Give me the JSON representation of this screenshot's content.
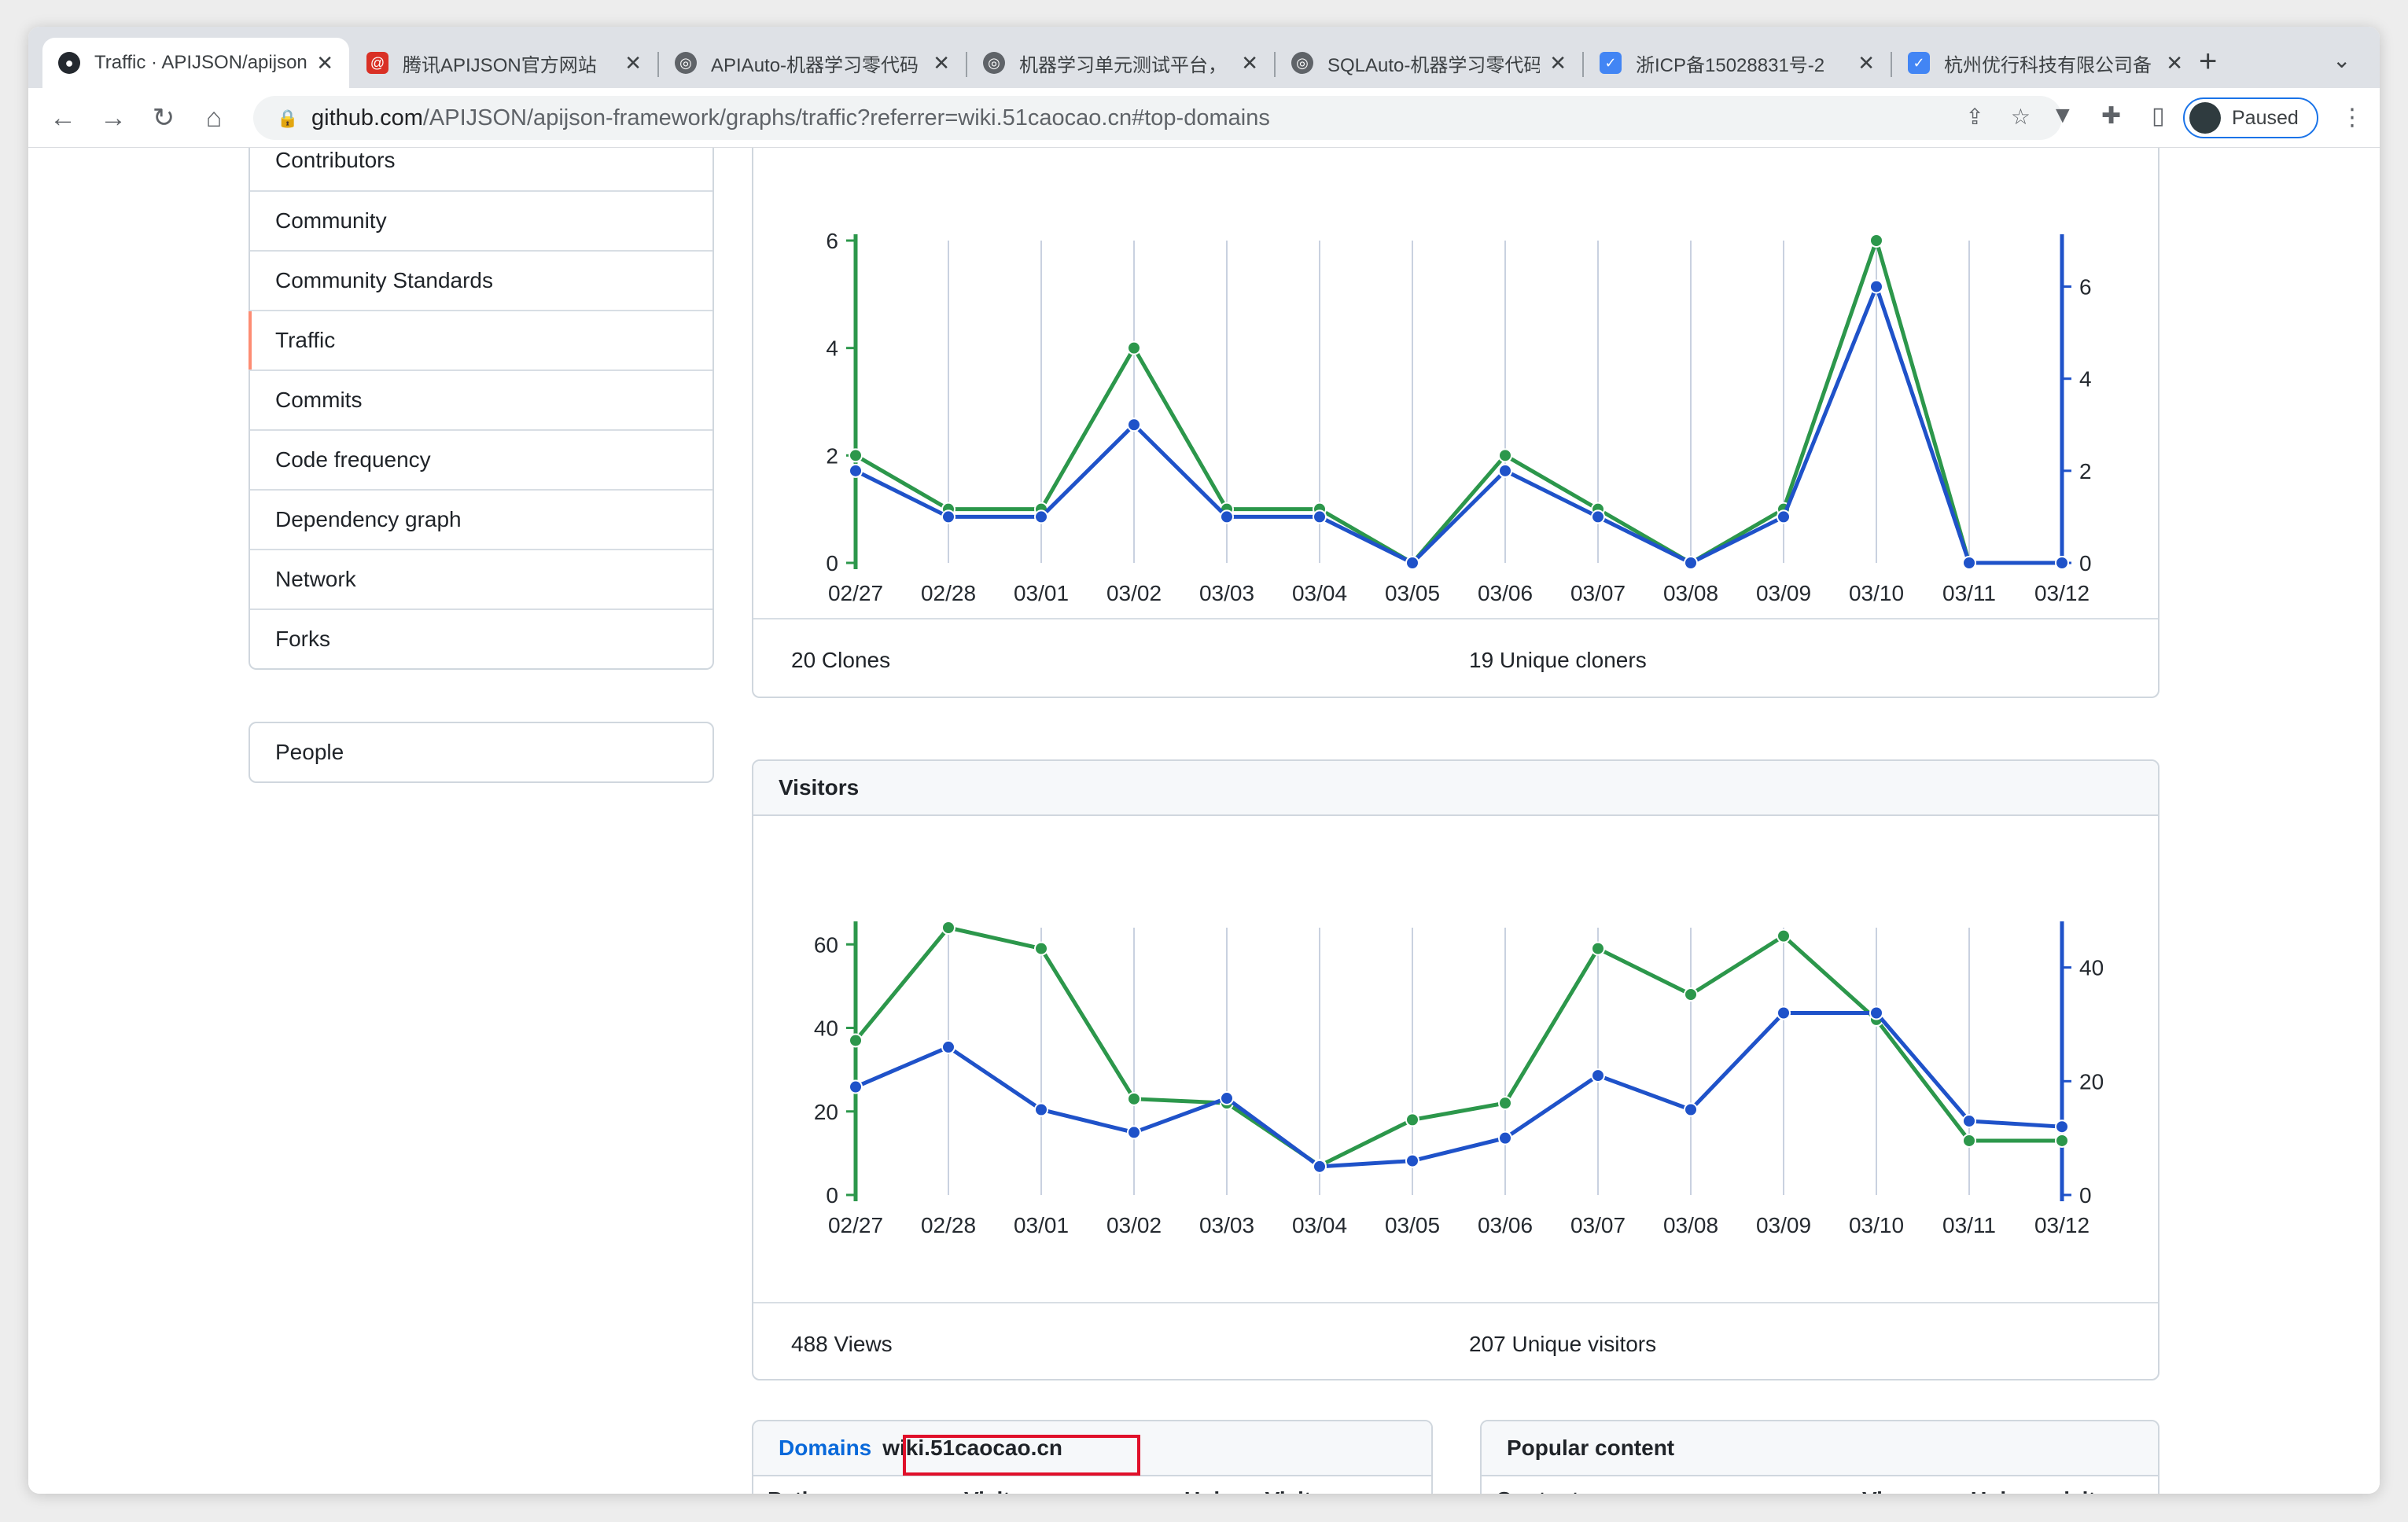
{
  "browser": {
    "tabs": [
      {
        "title": "Traffic · APIJSON/apijson",
        "favicon": "github-icon",
        "active": true
      },
      {
        "title": "腾讯APIJSON官方网站",
        "favicon": "site-icon"
      },
      {
        "title": "APIAuto-机器学习零代码",
        "favicon": "globe-icon"
      },
      {
        "title": "机器学习单元测试平台，",
        "favicon": "globe-icon"
      },
      {
        "title": "SQLAuto-机器学习零代码",
        "favicon": "globe-icon"
      },
      {
        "title": "浙ICP备15028831号-2",
        "favicon": "shield-icon"
      },
      {
        "title": "杭州优行科技有限公司备",
        "favicon": "shield-icon"
      }
    ],
    "url_host": "github.com",
    "url_rest": "/APIJSON/apijson-framework/graphs/traffic?referrer=wiki.51caocao.cn#top-domains",
    "profile_label": "Paused"
  },
  "sidebar": {
    "items": [
      {
        "label": "Contributors"
      },
      {
        "label": "Community"
      },
      {
        "label": "Community Standards"
      },
      {
        "label": "Traffic",
        "active": true
      },
      {
        "label": "Commits"
      },
      {
        "label": "Code frequency"
      },
      {
        "label": "Dependency graph"
      },
      {
        "label": "Network"
      },
      {
        "label": "Forks"
      }
    ],
    "people_label": "People"
  },
  "clones": {
    "total_label": "20 Clones",
    "unique_label": "19 Unique cloners"
  },
  "visitors": {
    "title": "Visitors",
    "total_label": "488 Views",
    "unique_label": "207 Unique visitors"
  },
  "domains": {
    "tab_label": "Domains",
    "value": "wiki.51caocao.cn",
    "columns": [
      "Path",
      "Visits",
      "Unique Visits"
    ]
  },
  "popular": {
    "title": "Popular content",
    "columns": [
      "Content",
      "Views",
      "Unique visitors"
    ]
  },
  "colors": {
    "green": "#2c974b",
    "blue": "#1f52c9",
    "accent": "#0969da"
  },
  "chart_data": [
    {
      "type": "line",
      "categories": [
        "02/27",
        "02/28",
        "03/01",
        "03/02",
        "03/03",
        "03/04",
        "03/05",
        "03/06",
        "03/07",
        "03/08",
        "03/09",
        "03/10",
        "03/11",
        "03/12"
      ],
      "series": [
        {
          "values": [
            2,
            1,
            1,
            4,
            1,
            1,
            0,
            2,
            1,
            0,
            1,
            6,
            0,
            0
          ],
          "axis": "left",
          "color": "#2c974b"
        },
        {
          "values": [
            2,
            1,
            1,
            3,
            1,
            1,
            0,
            2,
            1,
            0,
            1,
            6,
            0,
            0
          ],
          "axis": "right",
          "color": "#1f52c9"
        }
      ],
      "left_ticks": [
        "0",
        "2",
        "4",
        "6"
      ],
      "left_ylim": [
        0,
        6
      ],
      "right_ticks": [
        "0",
        "2",
        "4",
        "6"
      ],
      "right_ylim": [
        0,
        7
      ]
    },
    {
      "type": "line",
      "categories": [
        "02/27",
        "02/28",
        "03/01",
        "03/02",
        "03/03",
        "03/04",
        "03/05",
        "03/06",
        "03/07",
        "03/08",
        "03/09",
        "03/10",
        "03/11",
        "03/12"
      ],
      "series": [
        {
          "values": [
            37,
            64,
            59,
            23,
            22,
            7,
            18,
            22,
            59,
            48,
            62,
            42,
            13,
            13
          ],
          "axis": "left",
          "color": "#2c974b"
        },
        {
          "values": [
            19,
            26,
            15,
            11,
            17,
            5,
            6,
            10,
            21,
            15,
            32,
            32,
            13,
            12
          ],
          "axis": "right",
          "color": "#1f52c9"
        }
      ],
      "left_ticks": [
        "0",
        "20",
        "40",
        "60"
      ],
      "left_ylim": [
        0,
        64
      ],
      "right_ticks": [
        "0",
        "20",
        "40"
      ],
      "right_ylim": [
        0,
        47
      ]
    }
  ]
}
